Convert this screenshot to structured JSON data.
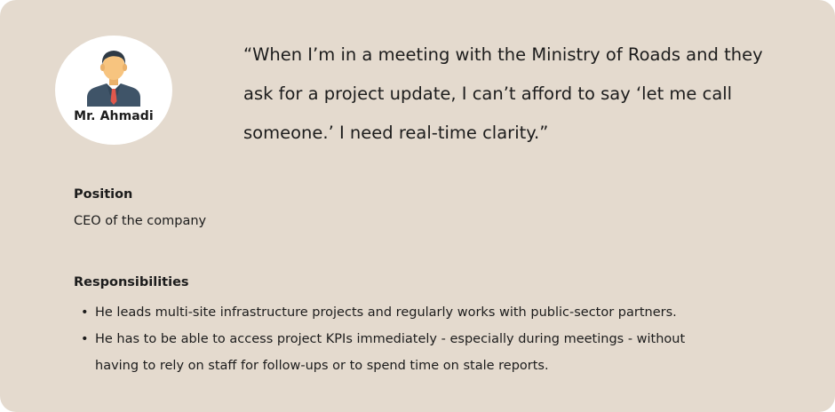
{
  "persona": {
    "name": "Mr. Ahmadi",
    "avatar_icon": "businessman-avatar-icon"
  },
  "quote": "“When I’m in a meeting with the Ministry of Roads and they ask for a project update, I can’t afford to say ‘let me call someone.’ I need real-time clarity.”",
  "position": {
    "label": "Position",
    "value": "CEO of the company"
  },
  "responsibilities": {
    "label": "Responsibilities",
    "items": [
      "He leads multi-site infrastructure projects and regularly works with public-sector partners.",
      "He has to be able to access project KPIs immediately - especially during meetings - without having to rely on staff for follow-ups or to spend time on stale reports."
    ]
  },
  "colors": {
    "card_background": "#e4dace",
    "avatar_background": "#ffffff",
    "suit": "#3f5468",
    "hair": "#2f3a45",
    "skin": "#f7c47f",
    "tie": "#e0584c",
    "text": "#1c1c1c"
  }
}
